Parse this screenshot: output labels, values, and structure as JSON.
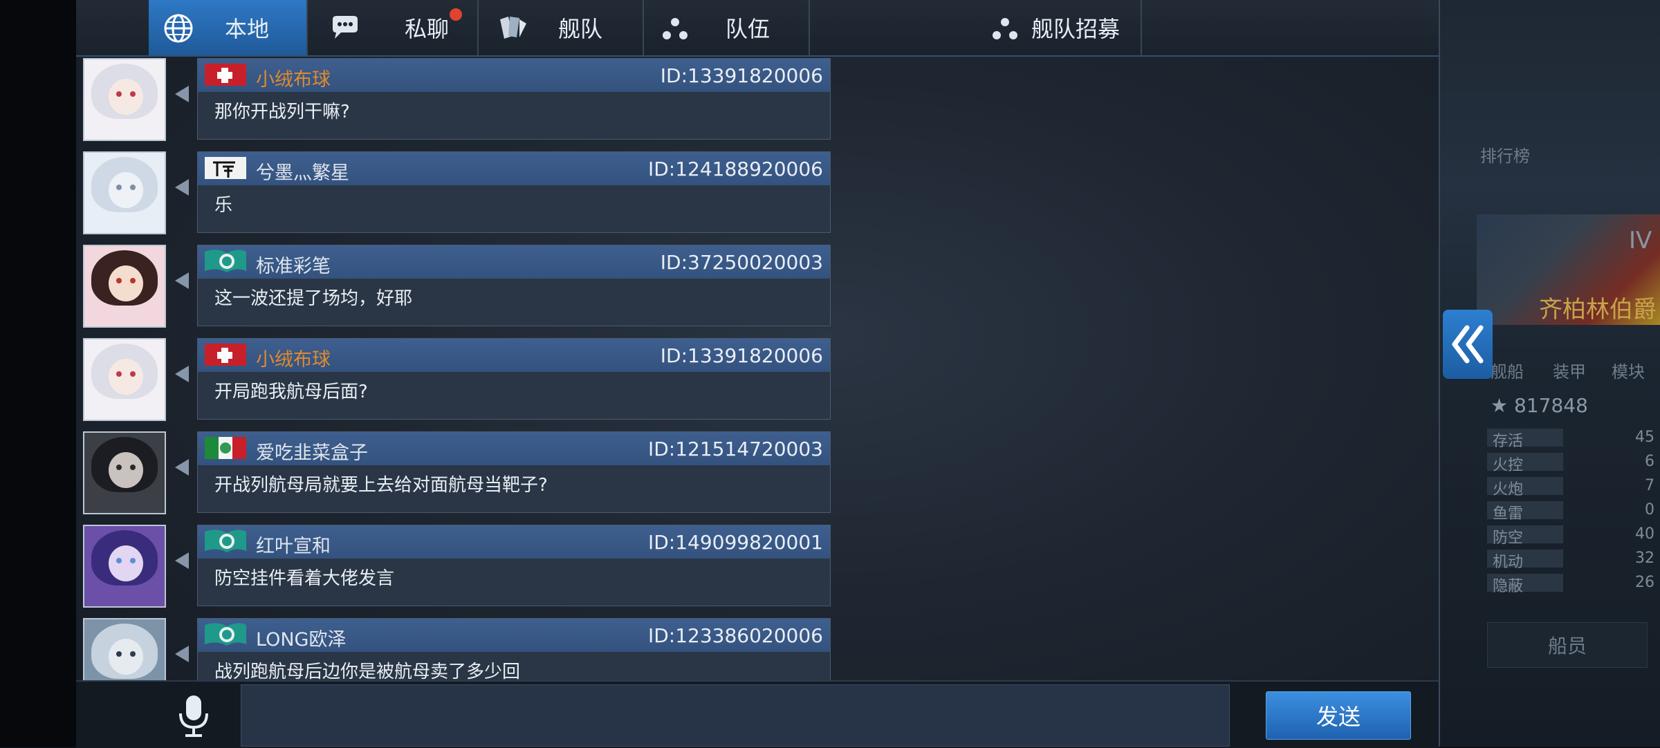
{
  "tabs": [
    {
      "label": "本地",
      "icon": "globe-icon",
      "active": true
    },
    {
      "label": "私聊",
      "icon": "speech-bubble-icon",
      "active": false,
      "badge": true
    },
    {
      "label": "舰队",
      "icon": "fleet-cards-icon",
      "active": false
    },
    {
      "label": "队伍",
      "icon": "team-dots-icon",
      "active": false
    },
    {
      "label": "舰队招募",
      "icon": "recruit-dots-icon",
      "active": false
    }
  ],
  "messages": [
    {
      "name": "小绒布球",
      "name_color": "#e08a2e",
      "id": "ID:13391820006",
      "text": "那你开战列干嘛?",
      "flag": "red-flag-icon"
    },
    {
      "name": "兮墨灬繁星",
      "name_color": "#dfe6ee",
      "id": "ID:124188920006",
      "text": "乐",
      "flag": "calligraphy-flag-icon"
    },
    {
      "name": "标准彩笔",
      "name_color": "#dfe6ee",
      "id": "ID:37250020003",
      "text": "这一波还提了场均，好耶",
      "flag": "green-emblem-flag-icon"
    },
    {
      "name": "小绒布球",
      "name_color": "#e08a2e",
      "id": "ID:13391820006",
      "text": "开局跑我航母后面?",
      "flag": "red-flag-icon"
    },
    {
      "name": "爱吃韭菜盒子",
      "name_color": "#dfe6ee",
      "id": "ID:121514720003",
      "text": "开战列航母局就要上去给对面航母当靶子?",
      "flag": "tricolor-flag-icon"
    },
    {
      "name": "红叶宣和",
      "name_color": "#dfe6ee",
      "id": "ID:149099820001",
      "text": "防空挂件看着大佬发言",
      "flag": "green-emblem-flag-icon"
    },
    {
      "name": "LONG欧泽",
      "name_color": "#dfe6ee",
      "id": "ID:123386020006",
      "text": "战列跑航母后边你是被航母卖了多少回",
      "flag": "green-emblem-flag-icon"
    }
  ],
  "input": {
    "placeholder": "",
    "value": ""
  },
  "send_label": "发送",
  "game": {
    "tier": "IV",
    "ship_name": "齐柏林伯爵",
    "power": "817848",
    "tabs": [
      "舰船",
      "装甲",
      "模块"
    ],
    "stats": [
      {
        "label": "存活",
        "value": "45"
      },
      {
        "label": "火控",
        "value": "6"
      },
      {
        "label": "火炮",
        "value": "7"
      },
      {
        "label": "鱼雷",
        "value": "0"
      },
      {
        "label": "防空",
        "value": "40"
      },
      {
        "label": "机动",
        "value": "32"
      },
      {
        "label": "隐蔽",
        "value": "26"
      }
    ],
    "crew_label": "船员",
    "leaderboard_label": "排行榜"
  },
  "colors": {
    "accent": "#2e78c4",
    "name_orange": "#e08a2e",
    "badge_red": "#e0432f"
  }
}
